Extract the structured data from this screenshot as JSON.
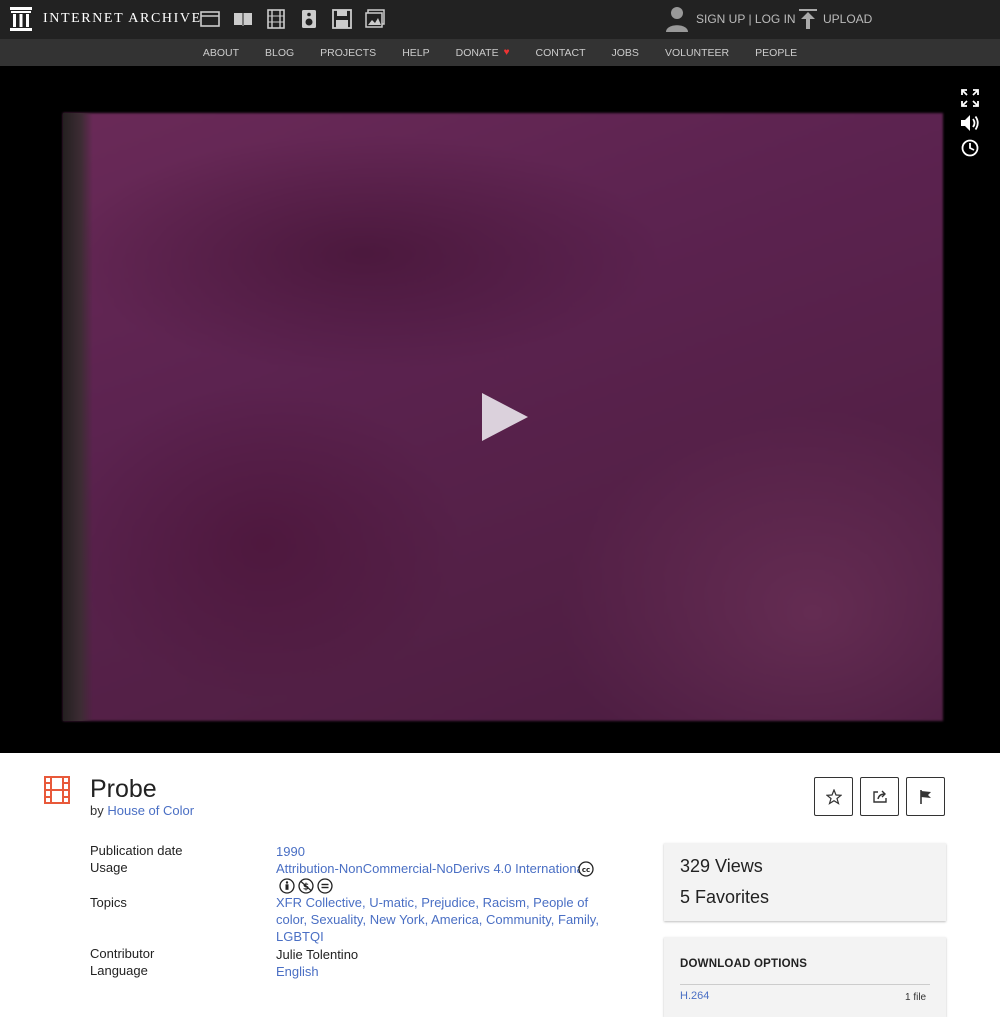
{
  "header": {
    "logo_text": "INTERNET ARCHIVE",
    "media_icons": [
      "web-icon",
      "texts-icon",
      "video-icon",
      "audio-icon",
      "software-icon",
      "images-icon"
    ],
    "account_link": "SIGN UP | LOG IN",
    "upload_link": "UPLOAD"
  },
  "subnav": {
    "items": [
      "ABOUT",
      "BLOG",
      "PROJECTS",
      "HELP",
      "DONATE",
      "CONTACT",
      "JOBS",
      "VOLUNTEER",
      "PEOPLE"
    ]
  },
  "player": {
    "controls": [
      "fullscreen-icon",
      "volume-icon",
      "clock-icon"
    ]
  },
  "item": {
    "title": "Probe",
    "by_prefix": "by",
    "creator": "House of Color"
  },
  "metadata": {
    "publication_date_label": "Publication date",
    "publication_date": "1990",
    "usage_label": "Usage",
    "usage": "Attribution-NonCommercial-NoDerivs 4.0 International",
    "topics_label": "Topics",
    "topics": "XFR Collective, U-matic, Prejudice, Racism, People of color, Sexuality, New York, America, Community, Family, LGBTQI",
    "contributor_label": "Contributor",
    "contributor": "Julie Tolentino",
    "language_label": "Language",
    "language": "English"
  },
  "stats": {
    "views": "329 Views",
    "favorites": "5 Favorites"
  },
  "downloads": {
    "heading": "DOWNLOAD OPTIONS",
    "format": "H.264",
    "count": "1 file"
  },
  "colors": {
    "topbar": "#222222",
    "subnav": "#333333",
    "link": "#4a6fc4",
    "item_icon": "#e8593a",
    "donate_heart": "#e33333"
  }
}
